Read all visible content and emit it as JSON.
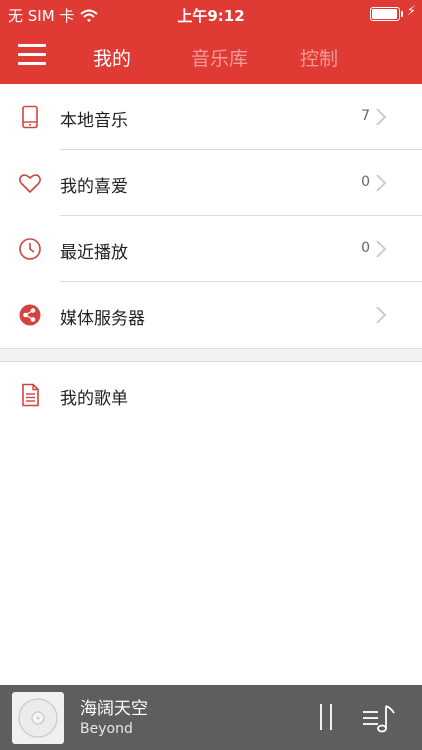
{
  "status": {
    "carrier": "无 SIM 卡",
    "time": "上午9:12",
    "battery_level": 1.0
  },
  "nav": {
    "menu_icon": "hamburger-menu-icon",
    "tabs": [
      {
        "label": "我的",
        "active": true
      },
      {
        "label": "音乐库",
        "active": false
      },
      {
        "label": "控制",
        "active": false
      }
    ]
  },
  "list": {
    "items": [
      {
        "label": "本地音乐",
        "count": "7",
        "icon": "phone-icon"
      },
      {
        "label": "我的喜爱",
        "count": "0",
        "icon": "heart-icon"
      },
      {
        "label": "最近播放",
        "count": "0",
        "icon": "clock-icon"
      },
      {
        "label": "媒体服务器",
        "count": "",
        "icon": "media-server-icon"
      }
    ],
    "playlist_item": {
      "label": "我的歌单",
      "icon": "document-icon"
    }
  },
  "player": {
    "title": "海阔天空",
    "artist": "Beyond",
    "album_art_icon": "disc-icon",
    "pause_icon": "pause-icon",
    "playlist_icon": "music-list-icon"
  },
  "colors": {
    "accent": "#e03a35",
    "tab_inactive": "#f29b97",
    "player_bg": "#5e5e60"
  }
}
